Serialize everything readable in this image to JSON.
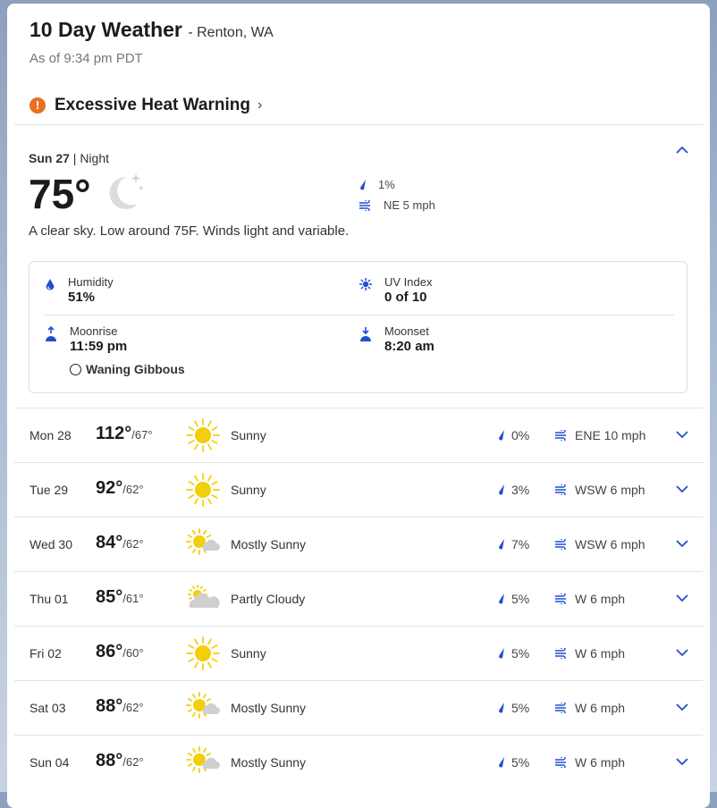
{
  "header": {
    "title": "10 Day Weather",
    "location": "- Renton, WA",
    "as_of": "As of 9:34 pm PDT"
  },
  "alert": {
    "label": "Excessive Heat Warning",
    "icon": "warning-icon",
    "color": "#e8711f"
  },
  "today": {
    "date": "Sun 27",
    "period": "| Night",
    "temp": "75°",
    "precip": "1%",
    "wind": "NE 5 mph",
    "description": "A clear sky. Low around 75F. Winds light and variable.",
    "humidity_label": "Humidity",
    "humidity": "51%",
    "uv_label": "UV Index",
    "uv": "0 of 10",
    "moonrise_label": "Moonrise",
    "moonrise": "11:59 pm",
    "moonset_label": "Moonset",
    "moonset": "8:20 am",
    "moon_phase": "Waning Gibbous"
  },
  "forecast": [
    {
      "day": "Mon 28",
      "hi": "112°",
      "lo": "/67°",
      "cond": "Sunny",
      "icon": "sunny",
      "precip": "0%",
      "wind": "ENE 10 mph"
    },
    {
      "day": "Tue 29",
      "hi": "92°",
      "lo": "/62°",
      "cond": "Sunny",
      "icon": "sunny",
      "precip": "3%",
      "wind": "WSW 6 mph"
    },
    {
      "day": "Wed 30",
      "hi": "84°",
      "lo": "/62°",
      "cond": "Mostly Sunny",
      "icon": "mostly-sunny",
      "precip": "7%",
      "wind": "WSW 6 mph"
    },
    {
      "day": "Thu 01",
      "hi": "85°",
      "lo": "/61°",
      "cond": "Partly Cloudy",
      "icon": "partly-cloudy",
      "precip": "5%",
      "wind": "W 6 mph"
    },
    {
      "day": "Fri 02",
      "hi": "86°",
      "lo": "/60°",
      "cond": "Sunny",
      "icon": "sunny",
      "precip": "5%",
      "wind": "W 6 mph"
    },
    {
      "day": "Sat 03",
      "hi": "88°",
      "lo": "/62°",
      "cond": "Mostly Sunny",
      "icon": "mostly-sunny",
      "precip": "5%",
      "wind": "W 6 mph"
    },
    {
      "day": "Sun 04",
      "hi": "88°",
      "lo": "/62°",
      "cond": "Mostly Sunny",
      "icon": "mostly-sunny",
      "precip": "5%",
      "wind": "W 6 mph"
    }
  ],
  "colors": {
    "accent": "#1f4fd1",
    "sun": "#f3cf0b",
    "cloud": "#c9c9c9"
  }
}
